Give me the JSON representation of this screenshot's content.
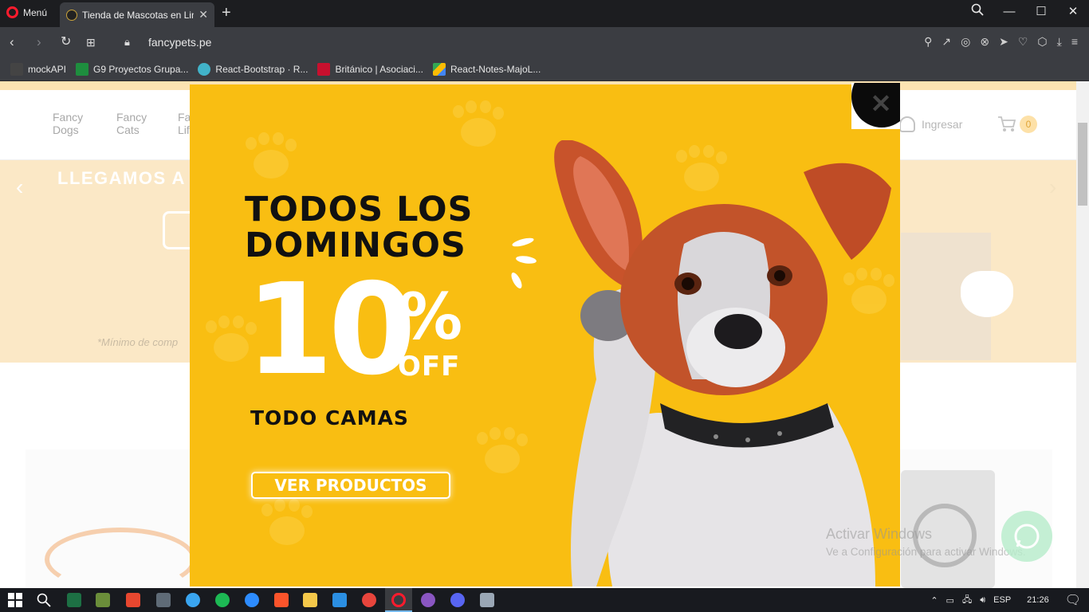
{
  "browser": {
    "menu_label": "Menú",
    "tab_title": "Tienda de Mascotas en Lim",
    "url": "fancypets.pe",
    "bookmarks": [
      {
        "label": "mockAPI",
        "color": "#444444"
      },
      {
        "label": "G9 Proyectos Grupa...",
        "color": "#1e8e3e"
      },
      {
        "label": "React-Bootstrap · R...",
        "color": "#41b3c9"
      },
      {
        "label": "Británico | Asociaci...",
        "color": "#c8102e"
      },
      {
        "label": "React-Notes-MajoL...",
        "color": "#fbbc04"
      }
    ]
  },
  "site": {
    "nav": [
      "Fancy\nDogs",
      "Fancy\nCats",
      "Fa\nLif"
    ],
    "login_label": "Ingresar",
    "cart_count": "0",
    "banner_title": "LLEGAMOS A",
    "banner_note": "*Mínimo de comp"
  },
  "popup": {
    "headline_1": "TODOS LOS",
    "headline_2": "DOMINGOS",
    "discount_number": "10",
    "discount_symbol": "%",
    "discount_word": "OFF",
    "category": "TODO CAMAS",
    "cta_label": "VER PRODUCTOS",
    "close_symbol": "✕",
    "bg_color": "#f9be12"
  },
  "overlay": {
    "activate_title": "Activar Windows",
    "activate_sub": "Ve a Configuración para activar Windows."
  },
  "taskbar": {
    "language": "ESP",
    "time": "21:26"
  }
}
